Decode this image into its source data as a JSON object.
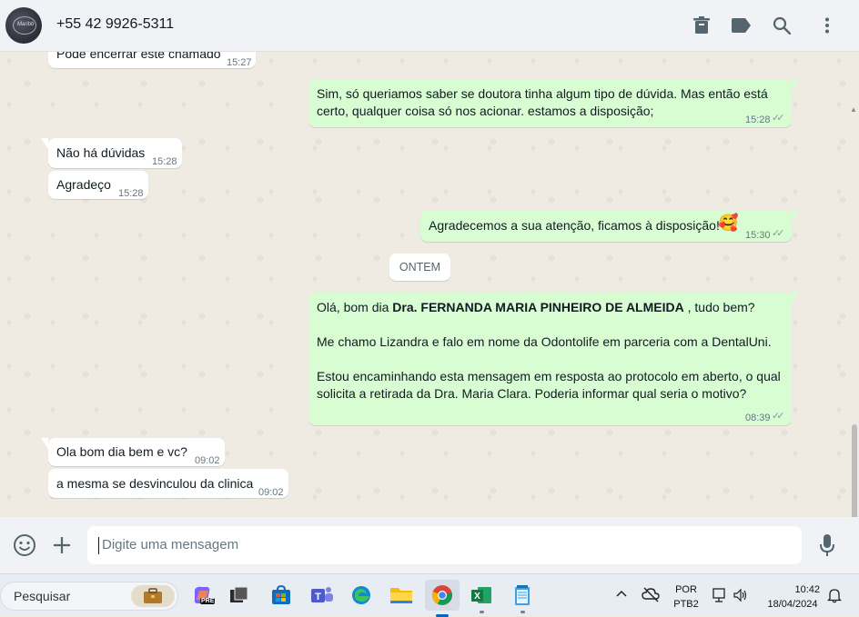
{
  "header": {
    "contact_name": "+55 42 9926-5311",
    "avatar_text": "Maribb",
    "icons": [
      "delete-icon",
      "label-icon",
      "search-icon",
      "menu-icon"
    ]
  },
  "chat": {
    "messages": [
      {
        "direction": "in",
        "text": "Pode encerrar este chamado",
        "time": "15:27"
      },
      {
        "direction": "out",
        "line1": "Sim, só queriamos saber se doutora tinha algum tipo de dúvida. Mas então está",
        "line2": "certo, qualquer coisa só nos acionar. estamos a disposição;",
        "time": "15:28"
      },
      {
        "direction": "in",
        "text": "Não há dúvidas",
        "time": "15:28"
      },
      {
        "direction": "in",
        "text": "Agradeço",
        "time": "15:28"
      },
      {
        "direction": "out",
        "text": "Agradecemos a sua atenção, ficamos à disposição!",
        "emoji": "🥰",
        "time": "15:30"
      },
      {
        "direction": "out",
        "greeting_pre": "Olá, bom dia ",
        "greeting_bold": "Dra. FERNANDA MARIA PINHEIRO DE ALMEIDA",
        "greeting_post": " , tudo bem?",
        "para2": "Me chamo Lizandra e falo em nome da Odontolife em parceria com a DentalUni.",
        "para3_line1": "Estou encaminhando esta mensagem em resposta ao protocolo em aberto, o qual",
        "para3_line2": "solicita a retirada da Dra. Maria Clara. Poderia informar qual seria o motivo?",
        "time": "08:39"
      },
      {
        "direction": "in",
        "text": "Ola bom dia bem e vc?",
        "time": "09:02"
      },
      {
        "direction": "in",
        "text": "a mesma se desvinculou da clinica",
        "time": "09:02"
      }
    ],
    "date_separator": "ONTEM"
  },
  "composer": {
    "placeholder": "Digite uma mensagem",
    "icons": [
      "emoji-icon",
      "attach-plus-icon",
      "microphone-icon"
    ]
  },
  "taskbar": {
    "search_label": "Pesquisar",
    "apps": [
      "briefcase-icon",
      "copilot-icon",
      "task-view-icon",
      "store-icon",
      "teams-icon",
      "edge-icon",
      "file-explorer-icon",
      "chrome-icon",
      "excel-icon",
      "notepad-icon"
    ],
    "language_line1": "POR",
    "language_line2": "PTB2",
    "time": "10:42",
    "date": "18/04/2024",
    "copilot_badge": "PRE"
  },
  "colors": {
    "outgoing_bubble": "#d9fdd3",
    "incoming_bubble": "#ffffff",
    "chat_background": "#efeae2",
    "read_ticks": "#8696a0"
  }
}
